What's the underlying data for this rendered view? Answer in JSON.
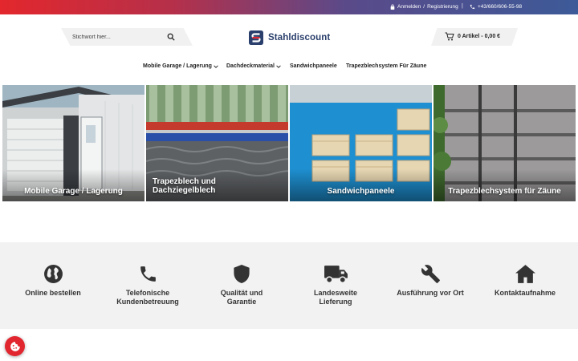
{
  "topbar": {
    "login": "Anmelden",
    "separator": "/",
    "register": "Registrierung",
    "divider": "|",
    "phone": "+43/660/606-55-98"
  },
  "search": {
    "placeholder": "Stichwort hier..."
  },
  "logo": {
    "text": "Stahldiscount",
    "icon": "stahldiscount-logo-icon"
  },
  "cart": {
    "label": "0 Artikel - 0,00 €"
  },
  "nav": {
    "items": [
      {
        "label": "Mobile Garage / Lagerung",
        "dropdown": true
      },
      {
        "label": "Dachdeckmaterial",
        "dropdown": true
      },
      {
        "label": "Sandwichpaneele",
        "dropdown": false
      },
      {
        "label": "Trapezblechsystem Für Zäune",
        "dropdown": false
      }
    ]
  },
  "categories": [
    {
      "label": "Mobile Garage / Lagerung"
    },
    {
      "label_line1": "Trapezblech und",
      "label_line2": "Dachziegelblech"
    },
    {
      "label": "Sandwichpaneele"
    },
    {
      "label": "Trapezblechsystem für Zäune"
    }
  ],
  "features": [
    {
      "icon": "globe-icon",
      "line1": "Online bestellen",
      "line2": ""
    },
    {
      "icon": "phone-icon",
      "line1": "Telefonische",
      "line2": "Kundenbetreuung"
    },
    {
      "icon": "shield-icon",
      "line1": "Qualität und",
      "line2": "Garantie"
    },
    {
      "icon": "truck-icon",
      "line1": "Landesweite",
      "line2": "Lieferung"
    },
    {
      "icon": "wrench-icon",
      "line1": "Ausführung vor Ort",
      "line2": ""
    },
    {
      "icon": "home-icon",
      "line1": "Kontaktaufnahme",
      "line2": ""
    }
  ],
  "colors": {
    "accent": "#e2262f",
    "brand": "#2a3f6c",
    "band": "#f2f2f2"
  }
}
